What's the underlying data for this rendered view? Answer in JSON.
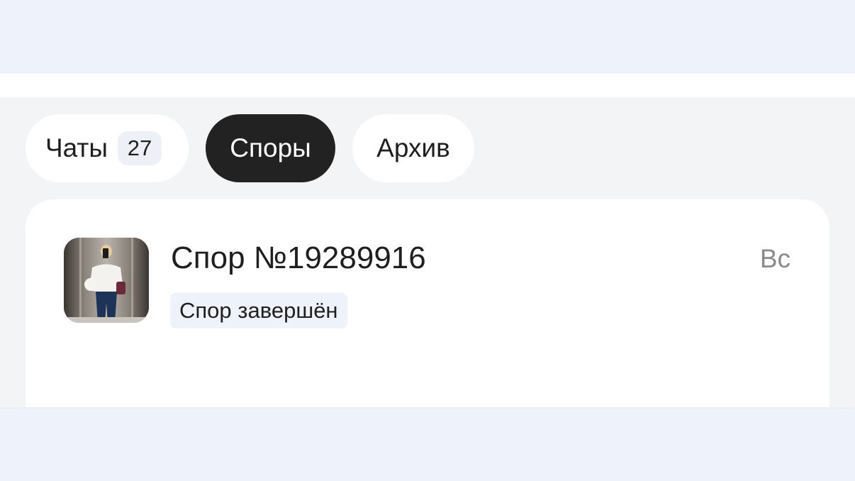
{
  "tabs": [
    {
      "label": "Чаты",
      "badge": "27",
      "active": false
    },
    {
      "label": "Споры",
      "active": true
    },
    {
      "label": "Архив",
      "active": false
    }
  ],
  "dispute": {
    "title": "Спор №19289916",
    "status": "Спор завершён",
    "date": "Вс",
    "avatar_icon": "product-photo"
  },
  "colors": {
    "page_background": "#eef2fb",
    "panel_background": "#f3f4f6",
    "active_tab": "#222222",
    "muted_text": "#8a8a8a"
  }
}
